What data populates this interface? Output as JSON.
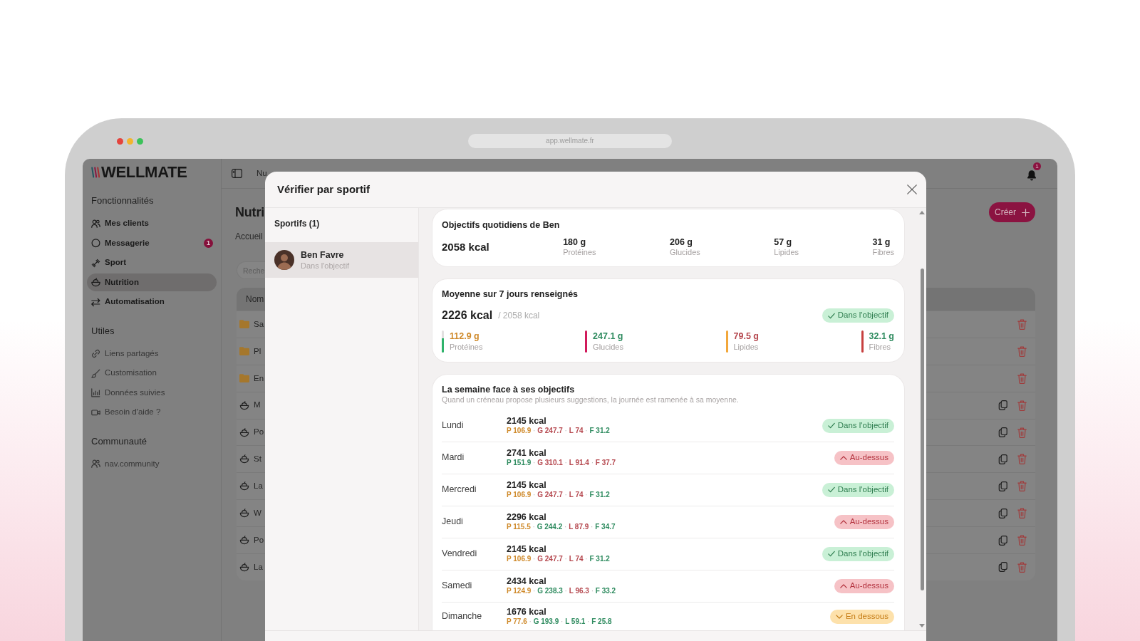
{
  "browser": {
    "url": "app.wellmate.fr"
  },
  "app": {
    "logo": "WELLMATE",
    "sidebar": [
      {
        "title": "Fonctionnalités",
        "kind": "main",
        "items": [
          {
            "label": "Mes clients",
            "selected": false
          },
          {
            "label": "Messagerie",
            "selected": false,
            "badge": "1"
          },
          {
            "label": "Sport",
            "selected": false
          },
          {
            "label": "Nutrition",
            "selected": true
          },
          {
            "label": "Automatisation",
            "selected": false
          }
        ]
      },
      {
        "title": "Utiles",
        "kind": "links",
        "items": [
          {
            "label": "Liens partagés",
            "selected": false
          },
          {
            "label": "Customisation",
            "selected": false
          },
          {
            "label": "Données suivies",
            "selected": false
          },
          {
            "label": "Besoin d'aide ?",
            "selected": false
          }
        ]
      },
      {
        "title": "Communauté",
        "kind": "links",
        "items": [
          {
            "label": "nav.community",
            "selected": false
          }
        ]
      }
    ],
    "topbar": {
      "breadcrumb": "Nu",
      "notification_count": "1"
    },
    "page": {
      "title": "Nutri",
      "breadcrumb": "Accueil",
      "create_button": "Créer",
      "search": {
        "placeholder": "Reche"
      },
      "table": {
        "columns": [
          "Nom"
        ],
        "rows": [
          {
            "name": "Sa",
            "kind": "folder"
          },
          {
            "name": "Pl",
            "kind": "folder"
          },
          {
            "name": "En",
            "kind": "folder"
          },
          {
            "name": "M",
            "kind": "meal"
          },
          {
            "name": "Po",
            "kind": "meal"
          },
          {
            "name": "St",
            "kind": "meal"
          },
          {
            "name": "La",
            "kind": "meal"
          },
          {
            "name": "W",
            "kind": "meal"
          },
          {
            "name": "Po",
            "kind": "meal"
          },
          {
            "name": "La",
            "kind": "meal"
          }
        ]
      }
    }
  },
  "dialog": {
    "title": "Vérifier par sportif",
    "athletes": {
      "heading": "Sportifs (1)",
      "items": [
        {
          "name": "Ben Favre",
          "status": "Dans l'objectif",
          "selected": true
        }
      ]
    },
    "targets": {
      "title": "Objectifs quotidiens de Ben",
      "kcal": "2058 kcal",
      "macros": [
        {
          "value": "180 g",
          "label": "Protéines"
        },
        {
          "value": "206 g",
          "label": "Glucides"
        },
        {
          "value": "57 g",
          "label": "Lipides"
        },
        {
          "value": "31 g",
          "label": "Fibres"
        }
      ]
    },
    "average": {
      "title": "Moyenne sur 7 jours renseignés",
      "kcal": "2226 kcal",
      "target": "/ 2058 kcal",
      "badge": {
        "kind": "within",
        "label": "Dans l'objectif"
      },
      "macros": [
        {
          "value": "112.9 g",
          "label": "Protéines",
          "color": "#cf8a2b",
          "bar": {
            "color": "#2fb36b",
            "level": 0.63
          }
        },
        {
          "value": "247.1 g",
          "label": "Glucides",
          "color": "#2e8b5f",
          "bar": {
            "color": "#d11a5b",
            "level": 1
          }
        },
        {
          "value": "79.5 g",
          "label": "Lipides",
          "color": "#b5474e",
          "bar": {
            "color": "#f2a73b",
            "level": 1
          }
        },
        {
          "value": "32.1 g",
          "label": "Fibres",
          "color": "#2e8b5f",
          "bar": {
            "color": "#c7403f",
            "level": 1
          }
        }
      ]
    },
    "week": {
      "title": "La semaine face à ses objectifs",
      "subtitle": "Quand un créneau propose plusieurs suggestions, la journée est ramenée à sa moyenne.",
      "separator": "·",
      "days": [
        {
          "day": "Lundi",
          "kcal": "2145 kcal",
          "macros": [
            {
              "text": "P 106.9",
              "color": "#cf8a2b"
            },
            {
              "text": "G 247.7",
              "color": "#b5474e"
            },
            {
              "text": "L 74",
              "color": "#b5474e"
            },
            {
              "text": "F 31.2",
              "color": "#2e8b5f"
            }
          ],
          "badge": {
            "kind": "within",
            "label": "Dans l'objectif"
          }
        },
        {
          "day": "Mardi",
          "kcal": "2741 kcal",
          "macros": [
            {
              "text": "P 151.9",
              "color": "#2e8b5f"
            },
            {
              "text": "G 310.1",
              "color": "#b5474e"
            },
            {
              "text": "L 91.4",
              "color": "#b5474e"
            },
            {
              "text": "F 37.7",
              "color": "#b5474e"
            }
          ],
          "badge": {
            "kind": "above",
            "label": "Au-dessus"
          }
        },
        {
          "day": "Mercredi",
          "kcal": "2145 kcal",
          "macros": [
            {
              "text": "P 106.9",
              "color": "#cf8a2b"
            },
            {
              "text": "G 247.7",
              "color": "#b5474e"
            },
            {
              "text": "L 74",
              "color": "#b5474e"
            },
            {
              "text": "F 31.2",
              "color": "#2e8b5f"
            }
          ],
          "badge": {
            "kind": "within",
            "label": "Dans l'objectif"
          }
        },
        {
          "day": "Jeudi",
          "kcal": "2296 kcal",
          "macros": [
            {
              "text": "P 115.5",
              "color": "#cf8a2b"
            },
            {
              "text": "G 244.2",
              "color": "#2e8b5f"
            },
            {
              "text": "L 87.9",
              "color": "#b5474e"
            },
            {
              "text": "F 34.7",
              "color": "#2e8b5f"
            }
          ],
          "badge": {
            "kind": "above",
            "label": "Au-dessus"
          }
        },
        {
          "day": "Vendredi",
          "kcal": "2145 kcal",
          "macros": [
            {
              "text": "P 106.9",
              "color": "#cf8a2b"
            },
            {
              "text": "G 247.7",
              "color": "#b5474e"
            },
            {
              "text": "L 74",
              "color": "#b5474e"
            },
            {
              "text": "F 31.2",
              "color": "#2e8b5f"
            }
          ],
          "badge": {
            "kind": "within",
            "label": "Dans l'objectif"
          }
        },
        {
          "day": "Samedi",
          "kcal": "2434 kcal",
          "macros": [
            {
              "text": "P 124.9",
              "color": "#cf8a2b"
            },
            {
              "text": "G 238.3",
              "color": "#2e8b5f"
            },
            {
              "text": "L 96.3",
              "color": "#b5474e"
            },
            {
              "text": "F 33.2",
              "color": "#2e8b5f"
            }
          ],
          "badge": {
            "kind": "above",
            "label": "Au-dessus"
          }
        },
        {
          "day": "Dimanche",
          "kcal": "1676 kcal",
          "macros": [
            {
              "text": "P 77.6",
              "color": "#cf8a2b"
            },
            {
              "text": "G 193.9",
              "color": "#2e8b5f"
            },
            {
              "text": "L 59.1",
              "color": "#2e8b5f"
            },
            {
              "text": "F 25.8",
              "color": "#2e8b5f"
            }
          ],
          "badge": {
            "kind": "below",
            "label": "En dessous"
          }
        }
      ]
    }
  }
}
